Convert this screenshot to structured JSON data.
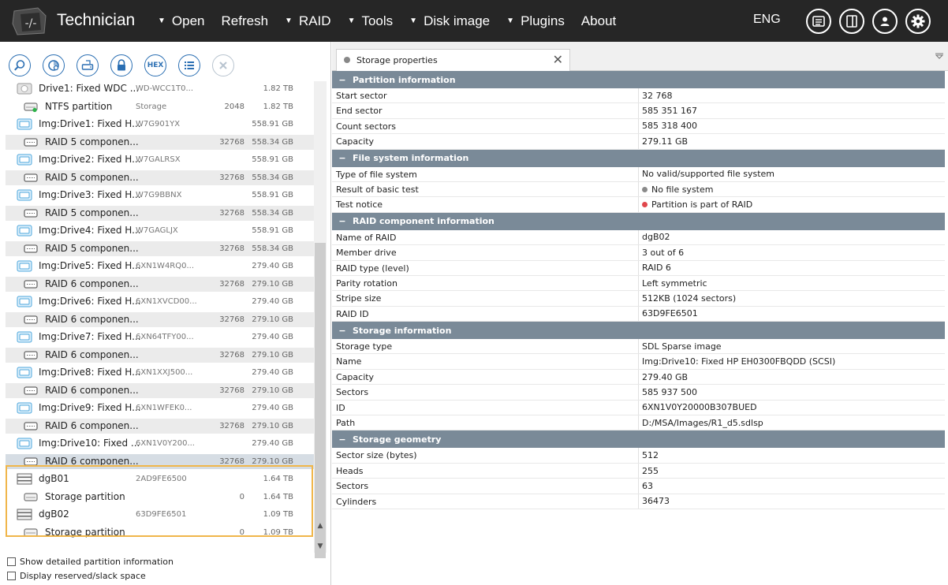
{
  "app": {
    "title": "Technician",
    "language": "ENG"
  },
  "menu": [
    {
      "label": "Open",
      "has_arrow": true
    },
    {
      "label": "Refresh",
      "has_arrow": false
    },
    {
      "label": "RAID",
      "has_arrow": true
    },
    {
      "label": "Tools",
      "has_arrow": true
    },
    {
      "label": "Disk image",
      "has_arrow": true
    },
    {
      "label": "Plugins",
      "has_arrow": true
    },
    {
      "label": "About",
      "has_arrow": false
    }
  ],
  "top_buttons": [
    "log-icon",
    "panel-icon",
    "user-icon",
    "gear-icon"
  ],
  "toolbar": {
    "buttons": [
      "search-icon",
      "scan-icon",
      "disk-image-icon",
      "lock-icon",
      "hex-icon",
      "list-icon",
      "close-icon"
    ],
    "hex_label": "HEX"
  },
  "tree": [
    {
      "name": "Drive1: Fixed WDC ...",
      "serial": "WD-WCC1T0...",
      "start": "",
      "size": "1.82 TB",
      "type": "drive",
      "indent": 1,
      "style": ""
    },
    {
      "name": "NTFS partition",
      "serial": "Storage",
      "start": "2048",
      "size": "1.82 TB",
      "type": "partition-green",
      "indent": 2,
      "style": ""
    },
    {
      "name": "Img:Drive1: Fixed H...",
      "serial": "W7G901YX",
      "start": "",
      "size": "558.91 GB",
      "type": "image",
      "indent": 1,
      "style": ""
    },
    {
      "name": "RAID 5 componen...",
      "serial": "",
      "start": "32768",
      "size": "558.34 GB",
      "type": "raid",
      "indent": 2,
      "style": "alt"
    },
    {
      "name": "Img:Drive2: Fixed H...",
      "serial": "W7GALRSX",
      "start": "",
      "size": "558.91 GB",
      "type": "image",
      "indent": 1,
      "style": ""
    },
    {
      "name": "RAID 5 componen...",
      "serial": "",
      "start": "32768",
      "size": "558.34 GB",
      "type": "raid",
      "indent": 2,
      "style": "alt"
    },
    {
      "name": "Img:Drive3: Fixed H...",
      "serial": "W7G9BBNX",
      "start": "",
      "size": "558.91 GB",
      "type": "image",
      "indent": 1,
      "style": ""
    },
    {
      "name": "RAID 5 componen...",
      "serial": "",
      "start": "32768",
      "size": "558.34 GB",
      "type": "raid",
      "indent": 2,
      "style": "alt"
    },
    {
      "name": "Img:Drive4: Fixed H...",
      "serial": "W7GAGLJX",
      "start": "",
      "size": "558.91 GB",
      "type": "image",
      "indent": 1,
      "style": ""
    },
    {
      "name": "RAID 5 componen...",
      "serial": "",
      "start": "32768",
      "size": "558.34 GB",
      "type": "raid",
      "indent": 2,
      "style": "alt"
    },
    {
      "name": "Img:Drive5: Fixed H...",
      "serial": "6XN1W4RQ0...",
      "start": "",
      "size": "279.40 GB",
      "type": "image",
      "indent": 1,
      "style": ""
    },
    {
      "name": "RAID 6 componen...",
      "serial": "",
      "start": "32768",
      "size": "279.10 GB",
      "type": "raid",
      "indent": 2,
      "style": "alt"
    },
    {
      "name": "Img:Drive6: Fixed H...",
      "serial": "6XN1XVCD00...",
      "start": "",
      "size": "279.40 GB",
      "type": "image",
      "indent": 1,
      "style": ""
    },
    {
      "name": "RAID 6 componen...",
      "serial": "",
      "start": "32768",
      "size": "279.10 GB",
      "type": "raid",
      "indent": 2,
      "style": "alt"
    },
    {
      "name": "Img:Drive7: Fixed H...",
      "serial": "6XN64TFY00...",
      "start": "",
      "size": "279.40 GB",
      "type": "image",
      "indent": 1,
      "style": ""
    },
    {
      "name": "RAID 6 componen...",
      "serial": "",
      "start": "32768",
      "size": "279.10 GB",
      "type": "raid",
      "indent": 2,
      "style": "alt"
    },
    {
      "name": "Img:Drive8: Fixed H...",
      "serial": "6XN1XXJ500...",
      "start": "",
      "size": "279.40 GB",
      "type": "image",
      "indent": 1,
      "style": ""
    },
    {
      "name": "RAID 6 componen...",
      "serial": "",
      "start": "32768",
      "size": "279.10 GB",
      "type": "raid",
      "indent": 2,
      "style": "alt"
    },
    {
      "name": "Img:Drive9: Fixed H...",
      "serial": "6XN1WFEK0...",
      "start": "",
      "size": "279.40 GB",
      "type": "image",
      "indent": 1,
      "style": ""
    },
    {
      "name": "RAID 6 componen...",
      "serial": "",
      "start": "32768",
      "size": "279.10 GB",
      "type": "raid",
      "indent": 2,
      "style": "alt"
    },
    {
      "name": "Img:Drive10: Fixed ...",
      "serial": "6XN1V0Y200...",
      "start": "",
      "size": "279.40 GB",
      "type": "image",
      "indent": 1,
      "style": ""
    },
    {
      "name": "RAID 6 componen...",
      "serial": "",
      "start": "32768",
      "size": "279.10 GB",
      "type": "raid",
      "indent": 2,
      "style": "sel"
    },
    {
      "name": "dgB01",
      "serial": "2AD9FE6500",
      "start": "",
      "size": "1.64 TB",
      "type": "array",
      "indent": 1,
      "style": ""
    },
    {
      "name": "Storage partition",
      "serial": "",
      "start": "0",
      "size": "1.64 TB",
      "type": "partition",
      "indent": 2,
      "style": ""
    },
    {
      "name": "dgB02",
      "serial": "63D9FE6501",
      "start": "",
      "size": "1.09 TB",
      "type": "array",
      "indent": 1,
      "style": ""
    },
    {
      "name": "Storage partition",
      "serial": "",
      "start": "0",
      "size": "1.09 TB",
      "type": "partition",
      "indent": 2,
      "style": ""
    }
  ],
  "options": [
    {
      "label": "Show detailed partition information",
      "checked": false
    },
    {
      "label": "Display reserved/slack space",
      "checked": false
    }
  ],
  "tab": {
    "label": "Storage properties"
  },
  "sections": [
    {
      "title": "Partition information",
      "rows": [
        {
          "k": "Start sector",
          "v": "32 768"
        },
        {
          "k": "End sector",
          "v": "585 351 167"
        },
        {
          "k": "Count sectors",
          "v": "585 318 400"
        },
        {
          "k": "Capacity",
          "v": "279.11 GB"
        }
      ]
    },
    {
      "title": "File system information",
      "rows": [
        {
          "k": "Type of file system",
          "v": "No valid/supported file system"
        },
        {
          "k": "Result of basic test",
          "v": "No file system",
          "dot": "#8a8a8a"
        },
        {
          "k": "Test notice",
          "v": "Partition is part of RAID",
          "dot": "#e0474c"
        }
      ]
    },
    {
      "title": "RAID component information",
      "rows": [
        {
          "k": "Name of RAID",
          "v": "dgB02"
        },
        {
          "k": "Member drive",
          "v": "3 out of 6"
        },
        {
          "k": "RAID type (level)",
          "v": "RAID 6"
        },
        {
          "k": "Parity rotation",
          "v": "Left symmetric"
        },
        {
          "k": "Stripe size",
          "v": "512KB (1024 sectors)"
        },
        {
          "k": "RAID ID",
          "v": "63D9FE6501"
        }
      ]
    },
    {
      "title": "Storage information",
      "rows": [
        {
          "k": "Storage type",
          "v": "SDL Sparse image"
        },
        {
          "k": "Name",
          "v": "Img:Drive10: Fixed HP EH0300FBQDD (SCSI)"
        },
        {
          "k": "Capacity",
          "v": "279.40 GB"
        },
        {
          "k": "Sectors",
          "v": "585 937 500"
        },
        {
          "k": "ID",
          "v": "6XN1V0Y20000B307BUED"
        },
        {
          "k": "Path",
          "v": "D:/MSA/Images/R1_d5.sdlsp"
        }
      ]
    },
    {
      "title": "Storage geometry",
      "rows": [
        {
          "k": "Sector size (bytes)",
          "v": "512"
        },
        {
          "k": "Heads",
          "v": "255"
        },
        {
          "k": "Sectors",
          "v": "63"
        },
        {
          "k": "Cylinders",
          "v": "36473"
        }
      ]
    }
  ]
}
